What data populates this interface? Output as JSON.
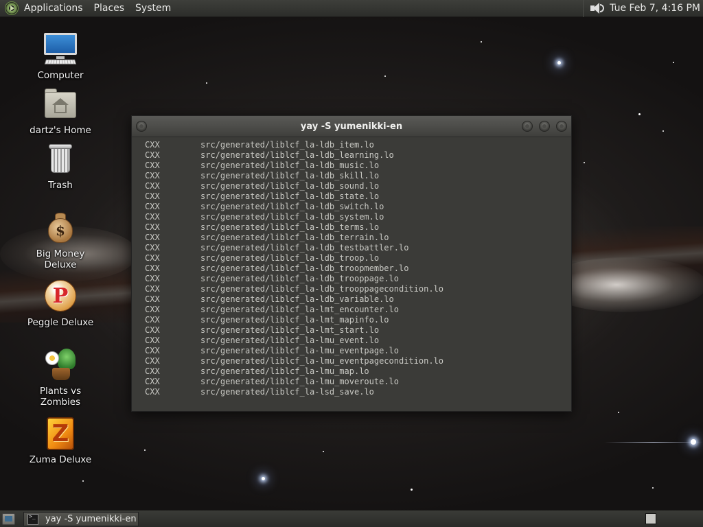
{
  "top_panel": {
    "menus": [
      "Applications",
      "Places",
      "System"
    ],
    "clock": "Tue Feb  7,  4:16 PM",
    "icons": {
      "logo": "app-menu-logo-icon",
      "volume": "speaker-icon"
    }
  },
  "desktop_icons": [
    {
      "label": "Computer",
      "icon": "computer-icon"
    },
    {
      "label": "dartz's Home",
      "icon": "home-folder-icon"
    },
    {
      "label": "Trash",
      "icon": "trash-icon"
    },
    {
      "label": "Big Money Deluxe",
      "icon": "money-bag-icon"
    },
    {
      "label": "Peggle Deluxe",
      "icon": "peggle-icon"
    },
    {
      "label": "Plants vs Zombies",
      "icon": "plants-vs-zombies-icon"
    },
    {
      "label": "Zuma Deluxe",
      "icon": "zuma-icon"
    }
  ],
  "terminal": {
    "title": "yay -S yumenikki-en",
    "lines": [
      {
        "tag": "CXX",
        "path": "src/generated/liblcf_la-ldb_item.lo"
      },
      {
        "tag": "CXX",
        "path": "src/generated/liblcf_la-ldb_learning.lo"
      },
      {
        "tag": "CXX",
        "path": "src/generated/liblcf_la-ldb_music.lo"
      },
      {
        "tag": "CXX",
        "path": "src/generated/liblcf_la-ldb_skill.lo"
      },
      {
        "tag": "CXX",
        "path": "src/generated/liblcf_la-ldb_sound.lo"
      },
      {
        "tag": "CXX",
        "path": "src/generated/liblcf_la-ldb_state.lo"
      },
      {
        "tag": "CXX",
        "path": "src/generated/liblcf_la-ldb_switch.lo"
      },
      {
        "tag": "CXX",
        "path": "src/generated/liblcf_la-ldb_system.lo"
      },
      {
        "tag": "CXX",
        "path": "src/generated/liblcf_la-ldb_terms.lo"
      },
      {
        "tag": "CXX",
        "path": "src/generated/liblcf_la-ldb_terrain.lo"
      },
      {
        "tag": "CXX",
        "path": "src/generated/liblcf_la-ldb_testbattler.lo"
      },
      {
        "tag": "CXX",
        "path": "src/generated/liblcf_la-ldb_troop.lo"
      },
      {
        "tag": "CXX",
        "path": "src/generated/liblcf_la-ldb_troopmember.lo"
      },
      {
        "tag": "CXX",
        "path": "src/generated/liblcf_la-ldb_trooppage.lo"
      },
      {
        "tag": "CXX",
        "path": "src/generated/liblcf_la-ldb_trooppagecondition.lo"
      },
      {
        "tag": "CXX",
        "path": "src/generated/liblcf_la-ldb_variable.lo"
      },
      {
        "tag": "CXX",
        "path": "src/generated/liblcf_la-lmt_encounter.lo"
      },
      {
        "tag": "CXX",
        "path": "src/generated/liblcf_la-lmt_mapinfo.lo"
      },
      {
        "tag": "CXX",
        "path": "src/generated/liblcf_la-lmt_start.lo"
      },
      {
        "tag": "CXX",
        "path": "src/generated/liblcf_la-lmu_event.lo"
      },
      {
        "tag": "CXX",
        "path": "src/generated/liblcf_la-lmu_eventpage.lo"
      },
      {
        "tag": "CXX",
        "path": "src/generated/liblcf_la-lmu_eventpagecondition.lo"
      },
      {
        "tag": "CXX",
        "path": "src/generated/liblcf_la-lmu_map.lo"
      },
      {
        "tag": "CXX",
        "path": "src/generated/liblcf_la-lmu_moveroute.lo"
      },
      {
        "tag": "CXX",
        "path": "src/generated/liblcf_la-lsd_save.lo"
      }
    ]
  },
  "bottom_panel": {
    "task_label": "yay -S yumenikki-en",
    "icons": {
      "show_desktop": "show-desktop-icon",
      "task": "terminal-icon",
      "workspace": "workspace-switcher-icon"
    }
  },
  "colors": {
    "panel_bg": "#2c2d2a",
    "terminal_bg": "#3b3b38",
    "terminal_text": "#c9c9c4"
  }
}
